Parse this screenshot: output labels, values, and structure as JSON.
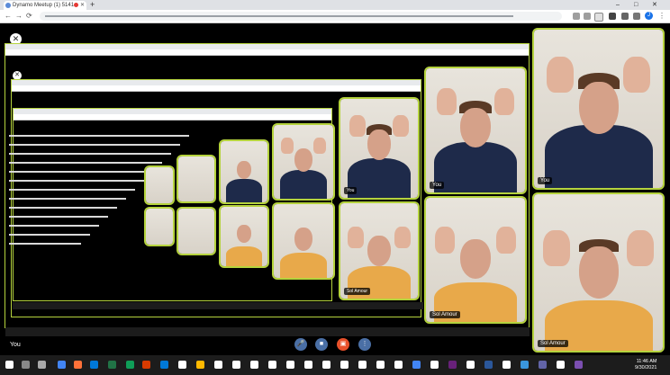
{
  "browser": {
    "tab_title": "Dynamo Meetup (1) 5141",
    "new_tab": "+",
    "window_controls": [
      "–",
      "□",
      "✕"
    ],
    "nav": [
      "←",
      "→",
      "⟳"
    ],
    "profile_initial": "J"
  },
  "meeting": {
    "participants": [
      {
        "name": "You"
      },
      {
        "name": "Sol Amour"
      }
    ],
    "self_label": "You",
    "nested_labels": {
      "you": "You",
      "sol": "Sol Amour"
    },
    "close_symbol": "✕",
    "controls": {
      "mic": "mic-icon",
      "camera": "camera-icon",
      "share": "share-screen-icon",
      "more": "⋮"
    }
  },
  "taskbar": {
    "time": "11:46 AM",
    "date": "9/30/2021"
  },
  "colors": {
    "accent_frame": "#b5d33d",
    "share_button": "#e8512b",
    "control_button": "#4a6fa5"
  }
}
